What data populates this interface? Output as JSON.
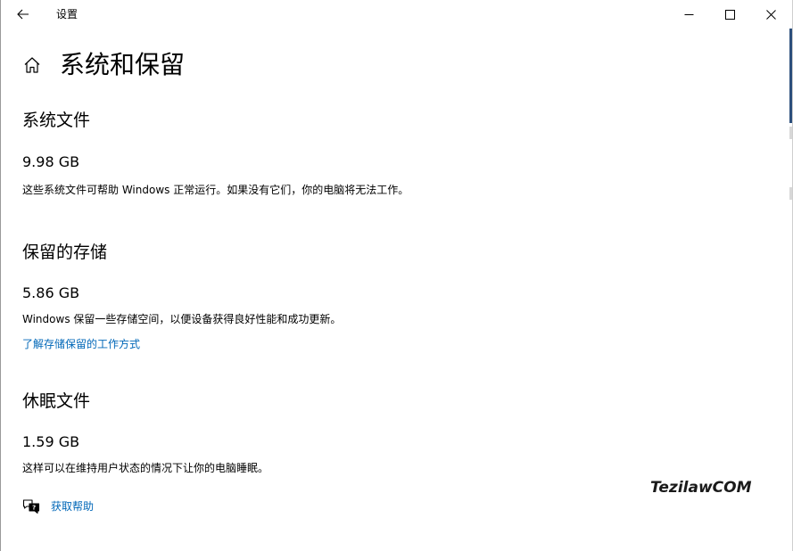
{
  "window": {
    "title": "设置"
  },
  "page": {
    "title": "系统和保留"
  },
  "sections": [
    {
      "title": "系统文件",
      "size": "9.98 GB",
      "description": "这些系统文件可帮助 Windows 正常运行。如果没有它们，你的电脑将无法工作。"
    },
    {
      "title": "保留的存储",
      "size": "5.86 GB",
      "description": "Windows 保留一些存储空间，以便设备获得良好性能和成功更新。",
      "link": "了解存储保留的工作方式"
    },
    {
      "title": "休眠文件",
      "size": "1.59 GB",
      "description": "这样可以在维持用户状态的情况下让你的电脑睡眠。"
    }
  ],
  "help": {
    "label": "获取帮助"
  },
  "watermark": "TezilawCOM",
  "colors": {
    "link": "#0067b8",
    "scroll_accent": "#2c4f7c"
  }
}
